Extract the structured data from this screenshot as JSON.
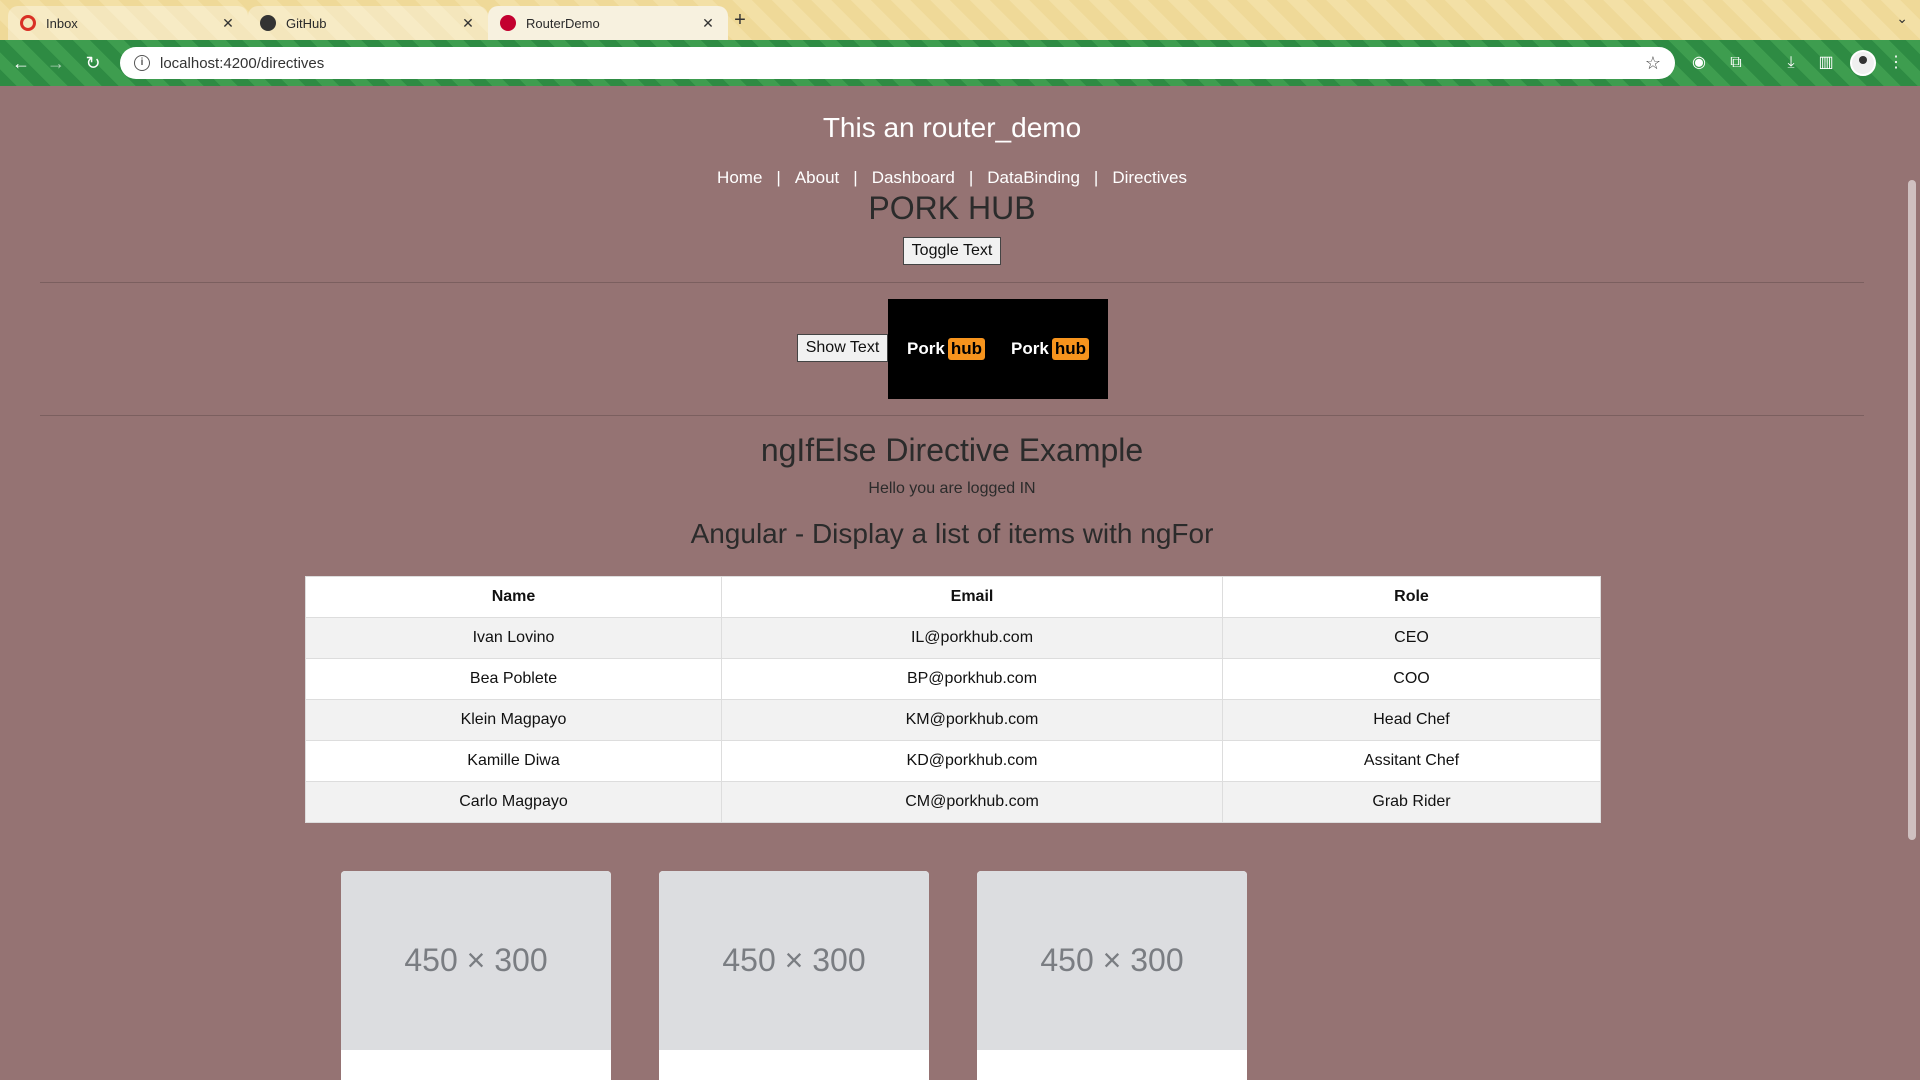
{
  "browser": {
    "tabs": [
      {
        "title": "Inbox",
        "favicon": "gmail-icon",
        "active": false
      },
      {
        "title": "GitHub",
        "favicon": "github-icon",
        "active": false
      },
      {
        "title": "RouterDemo",
        "favicon": "angular-icon",
        "active": true
      }
    ],
    "url": "localhost:4200/directives"
  },
  "page": {
    "app_title": "This an router_demo",
    "nav": [
      "Home",
      "About",
      "Dashboard",
      "DataBinding",
      "Directives"
    ],
    "nav_separator": "|",
    "brand_heading": "PORK HUB",
    "toggle_button": "Toggle Text",
    "show_button": "Show Text",
    "logos": [
      {
        "word": "Pork",
        "badge": "hub"
      },
      {
        "word": "Pork",
        "badge": "hub"
      }
    ],
    "ngif_heading": "ngIfElse Directive Example",
    "ngif_message": "Hello you are logged IN",
    "ngfor_heading": "Angular - Display a list of items with ngFor",
    "table": {
      "headers": [
        "Name",
        "Email",
        "Role"
      ],
      "rows": [
        [
          "Ivan Lovino",
          "IL@porkhub.com",
          "CEO"
        ],
        [
          "Bea Poblete",
          "BP@porkhub.com",
          "COO"
        ],
        [
          "Klein Magpayo",
          "KM@porkhub.com",
          "Head Chef"
        ],
        [
          "Kamille Diwa",
          "KD@porkhub.com",
          "Assitant Chef"
        ],
        [
          "Carlo Magpayo",
          "CM@porkhub.com",
          "Grab Rider"
        ]
      ]
    },
    "cards": [
      {
        "placeholder": "450 × 300"
      },
      {
        "placeholder": "450 × 300"
      },
      {
        "placeholder": "450 × 300"
      }
    ]
  },
  "colors": {
    "page_background": "#957373",
    "logo_badge": "#f7941d",
    "toolbar": "#2e8b43"
  }
}
